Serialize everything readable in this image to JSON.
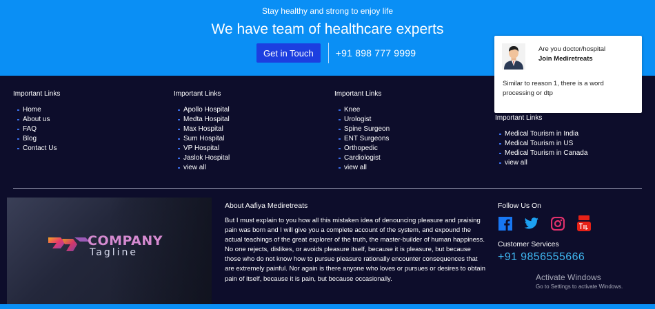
{
  "banner": {
    "tagline": "Stay healthy and strong to enjoy life",
    "headline": "We have team of healthcare experts",
    "cta_label": "Get in Touch",
    "phone": "+91 898 777 9999"
  },
  "columns": [
    {
      "title": "Important Links",
      "items": [
        "Home",
        "About us",
        "FAQ",
        "Blog",
        "Contact Us"
      ]
    },
    {
      "title": "Important Links",
      "items": [
        "Apollo Hospital",
        "Medta Hospital",
        "Max Hospital",
        "Sum Hospital",
        "VP Hospital",
        "Jaslok Hospital",
        "view all"
      ]
    },
    {
      "title": "Important Links",
      "items": [
        "Knee",
        "Urologist",
        "Spine Surgeon",
        "ENT Surgeons",
        "Orthopedic",
        "Cardiologist",
        "view all"
      ]
    },
    {
      "title": "Important Links",
      "items": [
        "Medical Tourism in India",
        "Medical Tourism in US",
        "Medical Tourism in Canada",
        "view all"
      ]
    }
  ],
  "card": {
    "question": "Are you doctor/hospital",
    "join": "Join Mediretreats",
    "body": "Similar to reason 1, there is a word processing or dtp"
  },
  "logo": {
    "word": "COMPANY",
    "sub": "Tagline"
  },
  "about": {
    "title": "About Aafiya Mediretreats",
    "text": "But I must explain to you how all this mistaken idea of denouncing pleasure and praising pain was born and I will give you a complete account of the system, and expound the actual teachings of the great explorer of the truth, the master-builder of human happiness. No one rejects, dislikes, or avoids pleasure itself, because it is pleasure, but because those who do not know how to pursue pleasure rationally encounter consequences that are extremely painful. Nor again is there anyone who loves or pursues or desires to obtain pain of itself, because it is pain, but because occasionally."
  },
  "follow": {
    "title": "Follow Us On",
    "icons": [
      "facebook-icon",
      "twitter-icon",
      "instagram-icon",
      "youtube-icon"
    ]
  },
  "customer": {
    "title": "Customer Services",
    "phone": "+91 9856555666"
  },
  "watermark": {
    "line1": "Activate Windows",
    "line2": "Go to Settings to activate Windows."
  },
  "colors": {
    "banner": "#0a8ff5",
    "footer": "#0d0d2b",
    "cta": "#1c3fe0",
    "accent_phone": "#3fb6f0"
  }
}
